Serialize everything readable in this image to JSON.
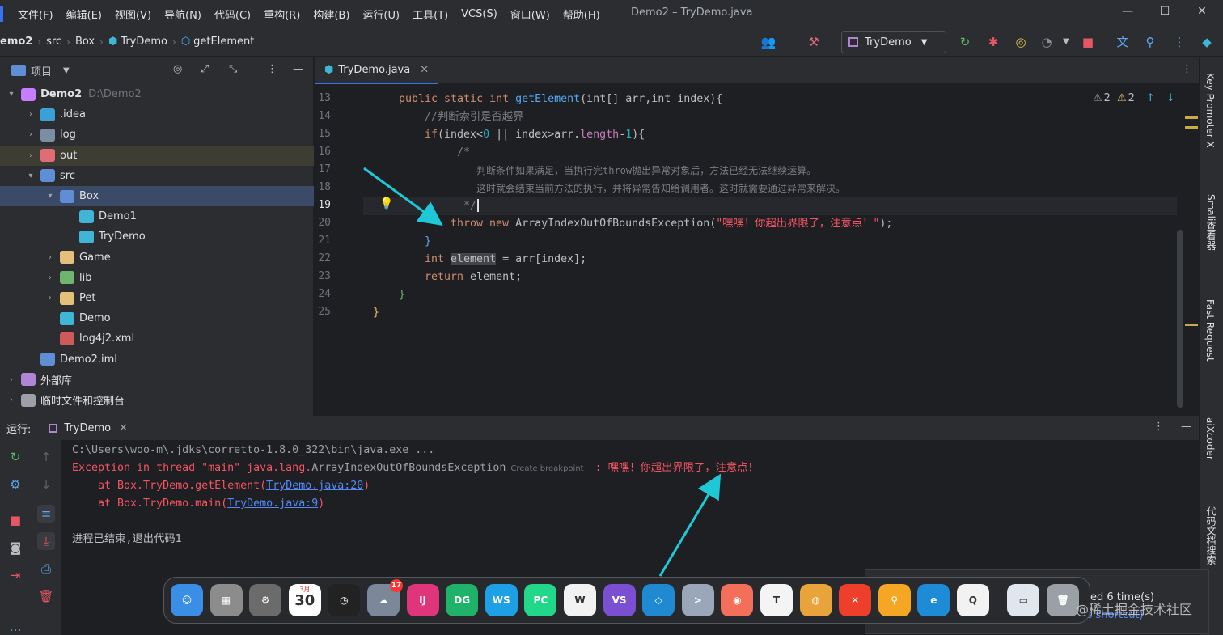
{
  "menu": {
    "items": [
      "文件(F)",
      "编辑(E)",
      "视图(V)",
      "导航(N)",
      "代码(C)",
      "重构(R)",
      "构建(B)",
      "运行(U)",
      "工具(T)",
      "VCS(S)",
      "窗口(W)",
      "帮助(H)"
    ],
    "title": "Demo2 – TryDemo.java"
  },
  "breadcrumb": [
    "emo2",
    "src",
    "Box",
    "TryDemo",
    "getElement"
  ],
  "toolbar": {
    "run_config": "TryDemo"
  },
  "project": {
    "header": "项目",
    "tree": [
      {
        "label": "Demo2",
        "hint": "D:\\Demo2",
        "depth": 0,
        "arrow": "▾",
        "color": "#c77dff"
      },
      {
        "label": ".idea",
        "depth": 1,
        "arrow": "›",
        "color": "#3aa0d8"
      },
      {
        "label": "log",
        "depth": 1,
        "arrow": "›",
        "color": "#7c8ea3"
      },
      {
        "label": "out",
        "depth": 1,
        "arrow": "›",
        "color": "#e06c75"
      },
      {
        "label": "src",
        "depth": 1,
        "arrow": "▾",
        "color": "#5f8ed6"
      },
      {
        "label": "Box",
        "depth": 2,
        "arrow": "▾",
        "color": "#5f8ed6"
      },
      {
        "label": "Demo1",
        "depth": 3,
        "arrow": "",
        "color": "#3fb6d8"
      },
      {
        "label": "TryDemo",
        "depth": 3,
        "arrow": "",
        "color": "#3fb6d8"
      },
      {
        "label": "Game",
        "depth": 2,
        "arrow": "›",
        "color": "#e5c07b"
      },
      {
        "label": "lib",
        "depth": 2,
        "arrow": "›",
        "color": "#6fb56f"
      },
      {
        "label": "Pet",
        "depth": 2,
        "arrow": "›",
        "color": "#e5c07b"
      },
      {
        "label": "Demo",
        "depth": 2,
        "arrow": "",
        "color": "#3fb6d8"
      },
      {
        "label": "log4j2.xml",
        "depth": 2,
        "arrow": "",
        "color": "#d05a5a"
      },
      {
        "label": "Demo2.iml",
        "depth": 1,
        "arrow": "",
        "color": "#5f8ed6"
      },
      {
        "label": "外部库",
        "depth": 0,
        "arrow": "›",
        "color": "#b085d6"
      },
      {
        "label": "临时文件和控制台",
        "depth": 0,
        "arrow": "›",
        "color": "#9da0a8"
      }
    ]
  },
  "editor": {
    "tab": "TryDemo.java",
    "warnings_a": "2",
    "warnings_b": "2",
    "line_numbers": [
      "13",
      "14",
      "15",
      "16",
      "17",
      "18",
      "19",
      "20",
      "21",
      "22",
      "23",
      "24",
      "25"
    ],
    "code": {
      "l13": [
        "public static int ",
        "getElement",
        "(int[] arr,int index){"
      ],
      "l14": "//判断索引是否越界",
      "l15": [
        "if",
        "(index<",
        "0",
        " || index>arr.",
        "length",
        "-",
        "1",
        "){"
      ],
      "l16": "/*",
      "l17": "判断条件如果满足，当执行完throw抛出异常对象后，方法已经无法继续运算。",
      "l18": "这时就会结束当前方法的执行，并将异常告知给调用者。这时就需要通过异常来解决。",
      "l19": "*/",
      "l20": [
        "throw new ",
        "ArrayIndexOutOfBoundsException",
        "(",
        "\"嘿嘿！你超出界限了，注意点！\"",
        ");"
      ],
      "l21": "}",
      "l22": [
        "int ",
        "element",
        " = arr[index];"
      ],
      "l23": [
        "return ",
        "element;"
      ],
      "l24": "}",
      "l25": "}"
    }
  },
  "right_tools": [
    "Key Promoter X",
    "Smali查看器",
    "Fast Request",
    "aiXcoder",
    "代码文档搜索"
  ],
  "run": {
    "label": "运行:",
    "tab": "TryDemo",
    "console": {
      "cmd": "C:\\Users\\woo-m\\.jdks\\corretto-1.8.0_322\\bin\\java.exe ...",
      "exception_prefix": "Exception in thread \"main\" java.lang.",
      "exception_class": "ArrayIndexOutOfBoundsException",
      "hint": "Create breakpoint",
      "exception_msg": " : 嘿嘿！你超出界限了，注意点！",
      "trace1_prefix": "    at Box.TryDemo.getElement(",
      "trace1_link": "TryDemo.java:20",
      "trace2_prefix": "    at Box.TryDemo.main(",
      "trace2_link": "TryDemo.java:9",
      "paren": ")",
      "exit": "进程已结束,退出代码1"
    }
  },
  "notification": {
    "text": "ed 6 time(s)",
    "subtext": "is shortcut)"
  },
  "dock": {
    "apps": [
      {
        "name": "Finder",
        "glyph": "☺",
        "color": "#3a8ee6"
      },
      {
        "name": "Launchpad",
        "glyph": "▦",
        "color": "#8c8c8c"
      },
      {
        "name": "System Preferences",
        "glyph": "⚙",
        "color": "#6b6b6b"
      },
      {
        "name": "Calendar",
        "glyph": "30",
        "color": "#ffffff"
      },
      {
        "name": "Clock",
        "glyph": "◷",
        "color": "#222222"
      },
      {
        "name": "Weather",
        "glyph": "☁",
        "color": "#7b8899"
      },
      {
        "name": "IntelliJ IDEA",
        "glyph": "IJ",
        "color": "#e0357a"
      },
      {
        "name": "DataGrip",
        "glyph": "DG",
        "color": "#1fb36a"
      },
      {
        "name": "WebStorm",
        "glyph": "WS",
        "color": "#1ea0e6"
      },
      {
        "name": "PyCharm",
        "glyph": "PC",
        "color": "#21d789"
      },
      {
        "name": "Word",
        "glyph": "W",
        "color": "#f2f2f2"
      },
      {
        "name": "Visual Studio",
        "glyph": "VS",
        "color": "#7b4fd1"
      },
      {
        "name": "VS Code",
        "glyph": "◇",
        "color": "#1f8ad2"
      },
      {
        "name": "Terminal",
        "glyph": ">",
        "color": "#9aa7b8"
      },
      {
        "name": "Screenshot",
        "glyph": "◉",
        "color": "#f36f5a"
      },
      {
        "name": "Typora",
        "glyph": "T",
        "color": "#f4f4f4"
      },
      {
        "name": "Chrome",
        "glyph": "◍",
        "color": "#e8a33a"
      },
      {
        "name": "XMind",
        "glyph": "✕",
        "color": "#ee3f2d"
      },
      {
        "name": "Search",
        "glyph": "⚲",
        "color": "#f5a623"
      },
      {
        "name": "Edge",
        "glyph": "e",
        "color": "#1e8bd6"
      },
      {
        "name": "QQ",
        "glyph": "Q",
        "color": "#f2f2f2"
      },
      {
        "name": "Window",
        "glyph": "▭",
        "color": "#dfe6ee"
      },
      {
        "name": "Trash",
        "glyph": "🗑",
        "color": "#9aa0a6"
      }
    ],
    "calendar_month": "3月",
    "weather_badge": "17"
  },
  "watermark": "@稀土掘金技术社区",
  "colors": {
    "accent": "#3574f0",
    "keyword": "#cf8e6d",
    "function": "#56a8f5",
    "string": "#f75464",
    "arrow": "#1fc8d6"
  }
}
